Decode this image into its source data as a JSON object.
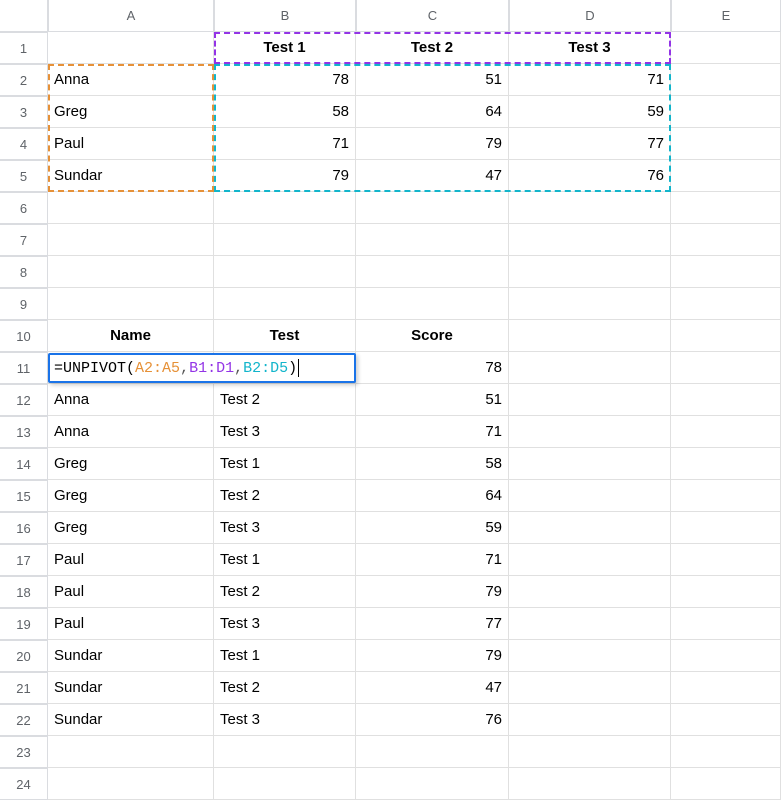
{
  "columns": [
    "A",
    "B",
    "C",
    "D",
    "E"
  ],
  "row_numbers": [
    1,
    2,
    3,
    4,
    5,
    6,
    7,
    8,
    9,
    10,
    11,
    12,
    13,
    14,
    15,
    16,
    17,
    18,
    19,
    20,
    21,
    22,
    23,
    24
  ],
  "top_table": {
    "headers": [
      "Test 1",
      "Test 2",
      "Test 3"
    ],
    "row_labels": [
      "Anna",
      "Greg",
      "Paul",
      "Sundar"
    ],
    "values": [
      [
        78,
        51,
        71
      ],
      [
        58,
        64,
        59
      ],
      [
        71,
        79,
        77
      ],
      [
        79,
        47,
        76
      ]
    ]
  },
  "output_headers": [
    "Name",
    "Test",
    "Score"
  ],
  "formula": {
    "prefix": "=",
    "fn": "UNPIVOT",
    "open": "(",
    "arg1": "A2:A5",
    "sep1": ",",
    "arg2": "B1:D1",
    "sep2": ",",
    "arg3": "B2:D5",
    "close": ")"
  },
  "formula_row_score": 78,
  "output_rows": [
    {
      "name": "Anna",
      "test": "Test 2",
      "score": 51
    },
    {
      "name": "Anna",
      "test": "Test 3",
      "score": 71
    },
    {
      "name": "Greg",
      "test": "Test 1",
      "score": 58
    },
    {
      "name": "Greg",
      "test": "Test 2",
      "score": 64
    },
    {
      "name": "Greg",
      "test": "Test 3",
      "score": 59
    },
    {
      "name": "Paul",
      "test": "Test 1",
      "score": 71
    },
    {
      "name": "Paul",
      "test": "Test 2",
      "score": 79
    },
    {
      "name": "Paul",
      "test": "Test 3",
      "score": 77
    },
    {
      "name": "Sundar",
      "test": "Test 1",
      "score": 79
    },
    {
      "name": "Sundar",
      "test": "Test 2",
      "score": 47
    },
    {
      "name": "Sundar",
      "test": "Test 3",
      "score": 76
    }
  ],
  "highlight_colors": {
    "range1": "#e69138",
    "range2": "#9334e6",
    "range3": "#12b5cb"
  },
  "chart_data": {
    "type": "table",
    "title": "UNPIVOT example",
    "input": {
      "row_labels": [
        "Anna",
        "Greg",
        "Paul",
        "Sundar"
      ],
      "col_labels": [
        "Test 1",
        "Test 2",
        "Test 3"
      ],
      "values": [
        [
          78,
          51,
          71
        ],
        [
          58,
          64,
          59
        ],
        [
          71,
          79,
          77
        ],
        [
          79,
          47,
          76
        ]
      ]
    },
    "output_columns": [
      "Name",
      "Test",
      "Score"
    ],
    "output": [
      [
        "Anna",
        "Test 1",
        78
      ],
      [
        "Anna",
        "Test 2",
        51
      ],
      [
        "Anna",
        "Test 3",
        71
      ],
      [
        "Greg",
        "Test 1",
        58
      ],
      [
        "Greg",
        "Test 2",
        64
      ],
      [
        "Greg",
        "Test 3",
        59
      ],
      [
        "Paul",
        "Test 1",
        71
      ],
      [
        "Paul",
        "Test 2",
        79
      ],
      [
        "Paul",
        "Test 3",
        77
      ],
      [
        "Sundar",
        "Test 1",
        79
      ],
      [
        "Sundar",
        "Test 2",
        47
      ],
      [
        "Sundar",
        "Test 3",
        76
      ]
    ]
  }
}
